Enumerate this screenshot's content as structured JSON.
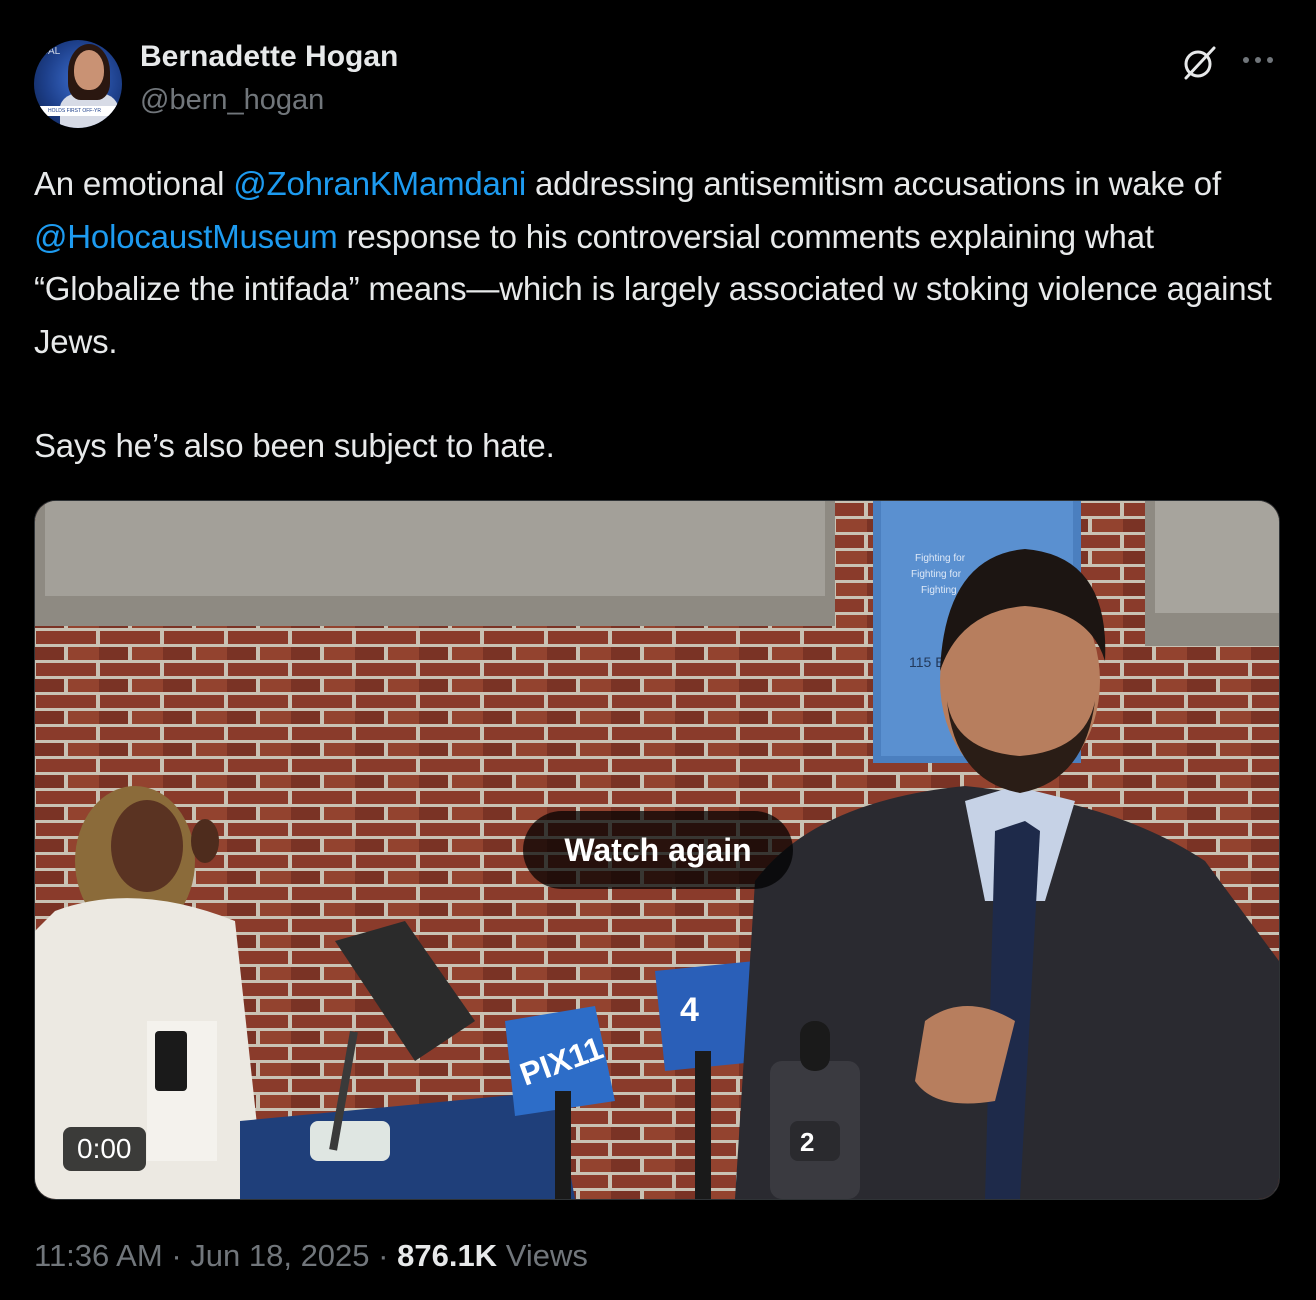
{
  "author": {
    "name": "Bernadette Hogan",
    "handle": "@bern_hogan",
    "avatar_tag": "ICAL",
    "avatar_chyron": "HOLDS FIRST OFF-YR"
  },
  "tweet": {
    "segments": [
      {
        "text": "An emotional ",
        "type": "text"
      },
      {
        "text": "@ZohranKMamdani",
        "type": "mention"
      },
      {
        "text": " addressing antisemitism accusations in wake of ",
        "type": "text"
      },
      {
        "text": "@HolocaustMuseum",
        "type": "mention"
      },
      {
        "text": " response to his controversial comments explaining what “Globalize the intifada” means—which is largely associated w stoking violence against Jews.",
        "type": "text"
      }
    ],
    "paragraph2": "Says he’s also been subject to hate."
  },
  "media": {
    "watch_again_label": "Watch again",
    "duration": "0:00",
    "sign_address": "115 Eas",
    "sign_lines": [
      "Fighting for",
      "Fighting for",
      "Fighting"
    ],
    "mic_labels": [
      "PIX11",
      "4",
      "2"
    ]
  },
  "meta": {
    "time": "11:36 AM",
    "separator": "·",
    "date": "Jun 18, 2025",
    "views_count": "876.1K",
    "views_label": "Views"
  },
  "icons": {
    "grok": "grok-icon",
    "more": "more-horizontal-icon"
  },
  "colors": {
    "background": "#000000",
    "text": "#e7e9ea",
    "secondary": "#71767b",
    "mention": "#1d9bf0"
  }
}
